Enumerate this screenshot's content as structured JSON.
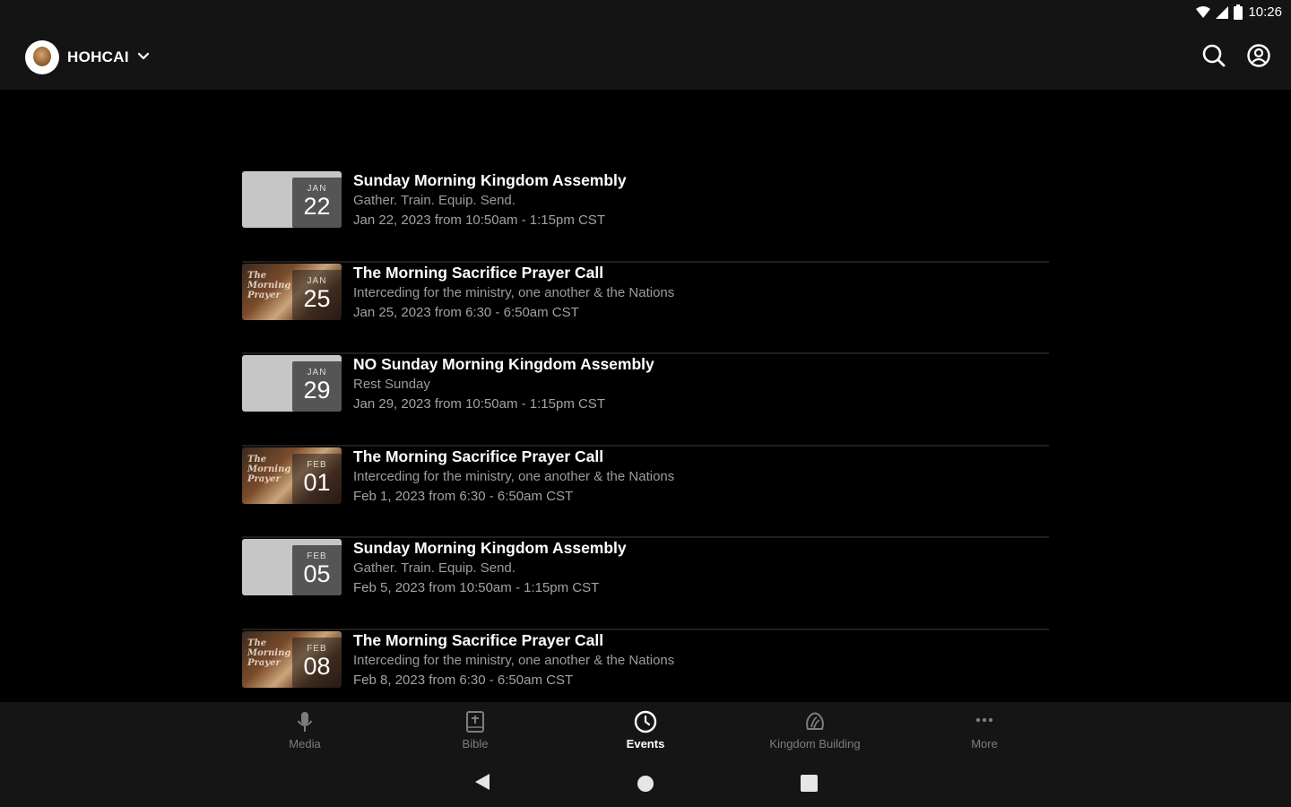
{
  "status_bar": {
    "time": "10:26"
  },
  "header": {
    "org_name": "HOHCAI"
  },
  "events": [
    {
      "month": "JAN",
      "day": "22",
      "title": "Sunday Morning Kingdom Assembly",
      "subtitle": "Gather. Train. Equip. Send.",
      "datetime": "Jan 22, 2023 from 10:50am - 1:15pm CST",
      "thumb": "plain"
    },
    {
      "month": "JAN",
      "day": "25",
      "title": "The Morning Sacrifice Prayer Call",
      "subtitle": "Interceding for the ministry, one another & the Nations",
      "datetime": "Jan 25, 2023 from 6:30 - 6:50am CST",
      "thumb": "photo"
    },
    {
      "month": "JAN",
      "day": "29",
      "title": "NO Sunday Morning Kingdom Assembly",
      "subtitle": "Rest Sunday",
      "datetime": "Jan 29, 2023 from 10:50am - 1:15pm CST",
      "thumb": "plain"
    },
    {
      "month": "FEB",
      "day": "01",
      "title": "The Morning Sacrifice Prayer Call",
      "subtitle": "Interceding for the ministry, one another & the Nations",
      "datetime": "Feb 1, 2023 from 6:30 - 6:50am CST",
      "thumb": "photo"
    },
    {
      "month": "FEB",
      "day": "05",
      "title": "Sunday Morning Kingdom Assembly",
      "subtitle": "Gather. Train. Equip. Send.",
      "datetime": "Feb 5, 2023 from 10:50am - 1:15pm CST",
      "thumb": "plain"
    },
    {
      "month": "FEB",
      "day": "08",
      "title": "The Morning Sacrifice Prayer Call",
      "subtitle": "Interceding for the ministry, one another & the Nations",
      "datetime": "Feb 8, 2023 from 6:30 - 6:50am CST",
      "thumb": "photo"
    }
  ],
  "thumb_banner": "The Morning Prayer",
  "bottom_nav": [
    {
      "label": "Media",
      "icon": "microphone-icon",
      "active": false
    },
    {
      "label": "Bible",
      "icon": "bible-icon",
      "active": false
    },
    {
      "label": "Events",
      "icon": "clock-icon",
      "active": true
    },
    {
      "label": "Kingdom Building",
      "icon": "kingdom-building-icon",
      "active": false
    },
    {
      "label": "More",
      "icon": "more-icon",
      "active": false
    }
  ],
  "colors": {
    "background": "#000000",
    "bar": "#151515",
    "muted_text": "#9c9c9c",
    "active": "#ffffff",
    "inactive": "#7d7d7d"
  }
}
